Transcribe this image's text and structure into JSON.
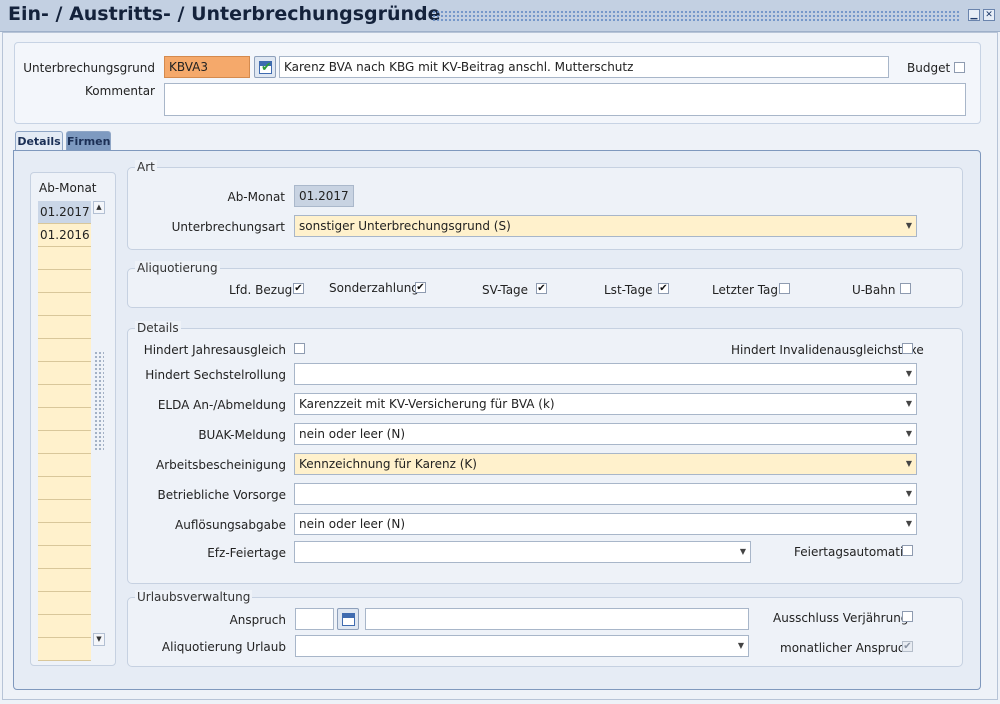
{
  "window": {
    "title": "Ein- / Austritts- / Unterbrechungsgründe",
    "minimize_glyph": "▁",
    "close_glyph": "✕"
  },
  "header": {
    "reason_label": "Unterbrechungsgrund",
    "reason_code": "KBVA3",
    "reason_text": "Karenz BVA nach KBG mit KV-Beitrag anschl. Mutterschutz",
    "budget_label": "Budget",
    "budget_checked": false,
    "comment_label": "Kommentar",
    "comment_value": ""
  },
  "tabs": [
    {
      "label": "Details",
      "active": true
    },
    {
      "label": "Firmen",
      "active": false
    }
  ],
  "months": {
    "header": "Ab-Monat",
    "items": [
      "01.2017",
      "01.2016",
      "",
      "",
      "",
      "",
      "",
      "",
      "",
      "",
      "",
      "",
      "",
      "",
      "",
      "",
      "",
      "",
      "",
      ""
    ],
    "selected_index": 0,
    "scroll_up": "▲",
    "scroll_down": "▼"
  },
  "art": {
    "legend": "Art",
    "ab_monat_label": "Ab-Monat",
    "ab_monat_value": "01.2017",
    "unterbrechungsart_label": "Unterbrechungsart",
    "unterbrechungsart_value": "sonstiger Unterbrechungsgrund (S)"
  },
  "aliquotierung": {
    "legend": "Aliquotierung",
    "items": [
      {
        "label": "Lfd. Bezug",
        "checked": true
      },
      {
        "label": "Sonderzahlung",
        "checked": true
      },
      {
        "label": "SV-Tage",
        "checked": true
      },
      {
        "label": "Lst-Tage",
        "checked": true
      },
      {
        "label": "Letzter Tag",
        "checked": false
      },
      {
        "label": "U-Bahn",
        "checked": false
      }
    ]
  },
  "details": {
    "legend": "Details",
    "hindert_jahresausgleich_label": "Hindert Jahresausgleich",
    "hindert_jahresausgleich": false,
    "hindert_invalidenausgleichstaxe_label": "Hindert Invalidenausgleichstaxe",
    "hindert_invalidenausgleichstaxe": false,
    "fields": [
      {
        "label": "Hindert Sechstelrollung",
        "value": "",
        "highlight": false
      },
      {
        "label": "ELDA An-/Abmeldung",
        "value": "Karenzzeit mit KV-Versicherung für BVA (k)",
        "highlight": false
      },
      {
        "label": "BUAK-Meldung",
        "value": "nein oder leer (N)",
        "highlight": false
      },
      {
        "label": "Arbeitsbescheinigung",
        "value": "Kennzeichnung für Karenz (K)",
        "highlight": true
      },
      {
        "label": "Betriebliche Vorsorge",
        "value": "",
        "highlight": false
      },
      {
        "label": "Auflösungsabgabe",
        "value": "nein oder leer (N)",
        "highlight": false
      }
    ],
    "efz_feiertage_label": "Efz-Feiertage",
    "efz_feiertage_value": "",
    "feiertagsautomatik_label": "Feiertagsautomatik",
    "feiertagsautomatik": false
  },
  "urlaub": {
    "legend": "Urlaubsverwaltung",
    "anspruch_label": "Anspruch",
    "anspruch_value": "",
    "anspruch_text": "",
    "aliquotierung_label": "Aliquotierung Urlaub",
    "aliquotierung_value": "",
    "ausschluss_label": "Ausschluss Verjährung",
    "ausschluss": false,
    "monatlicher_label": "monatlicher Anspruch",
    "monatlicher": true
  },
  "icons": {
    "dropdown": "chevron-down-icon",
    "calendar": "calendar-icon",
    "check": "✔"
  },
  "colors": {
    "accent_orange": "#f5a96b",
    "highlight_yellow": "#fff1cc",
    "title_bar": "#c3d0e2"
  }
}
